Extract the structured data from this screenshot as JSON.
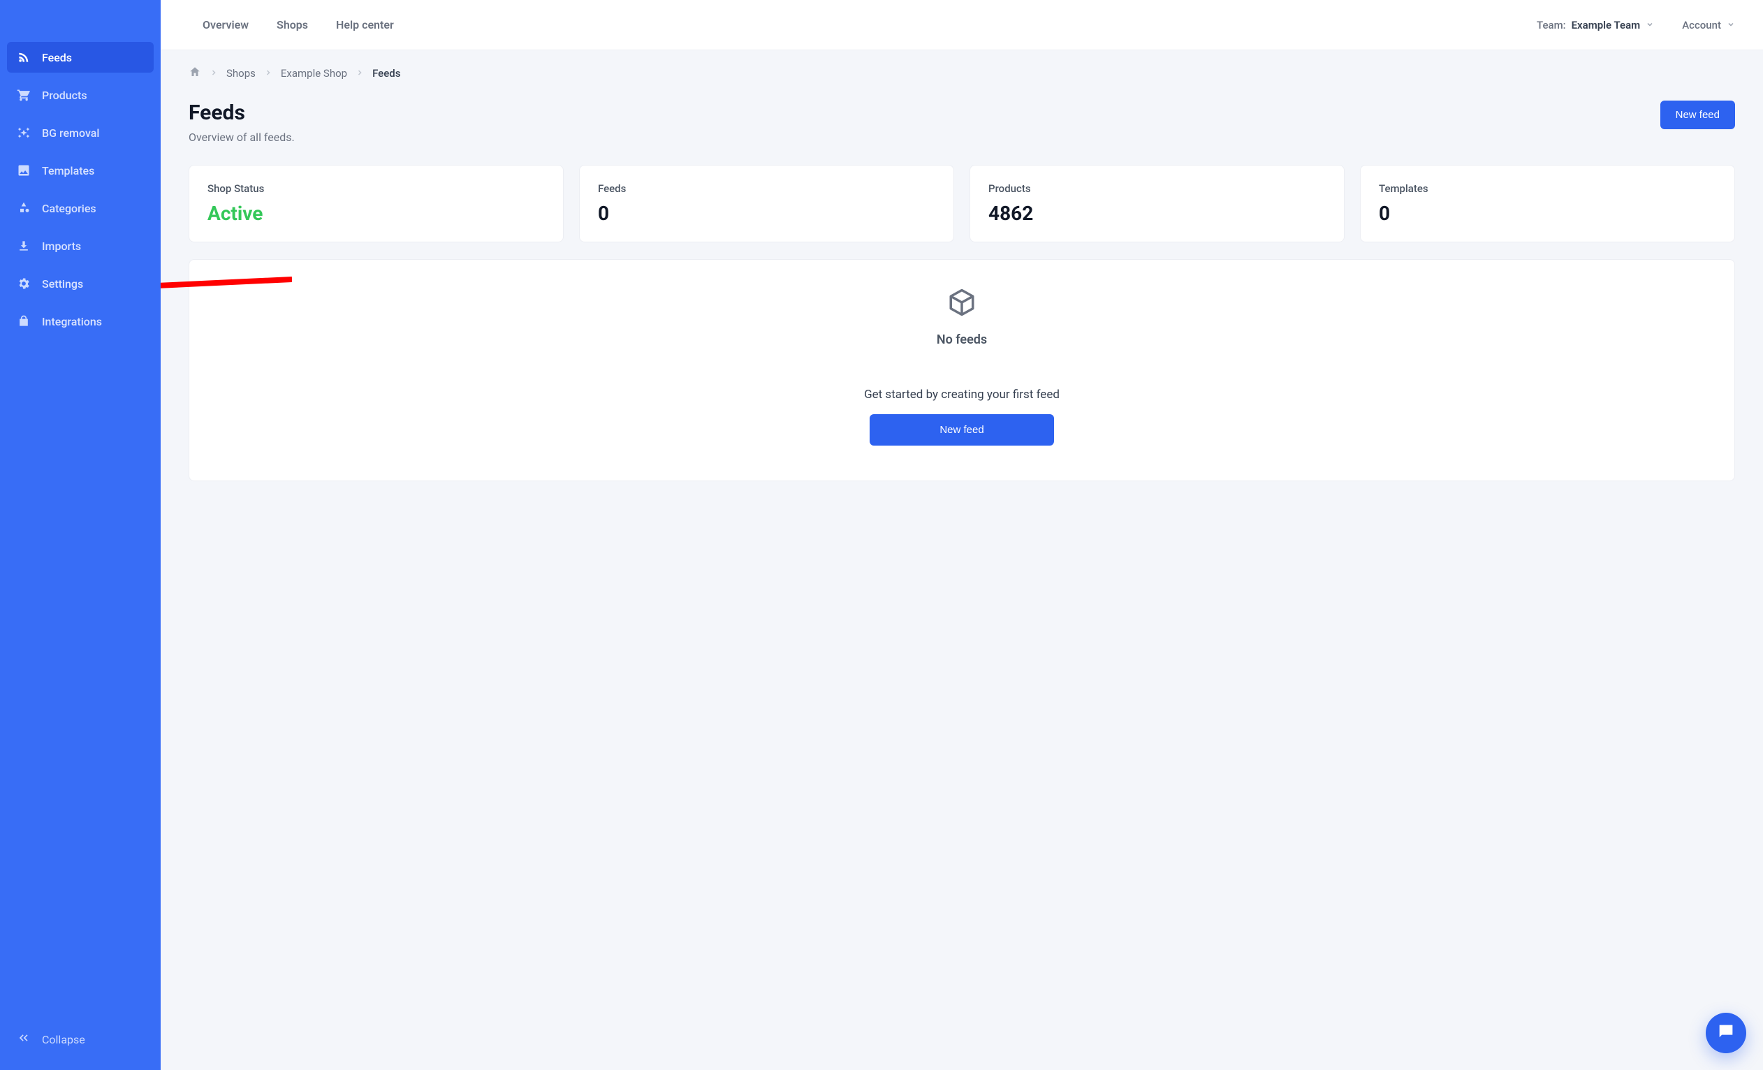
{
  "sidebar": {
    "items": [
      {
        "label": "Feeds",
        "name": "sidebar-item-feeds",
        "active": true
      },
      {
        "label": "Products",
        "name": "sidebar-item-products",
        "active": false
      },
      {
        "label": "BG removal",
        "name": "sidebar-item-bg-removal",
        "active": false
      },
      {
        "label": "Templates",
        "name": "sidebar-item-templates",
        "active": false
      },
      {
        "label": "Categories",
        "name": "sidebar-item-categories",
        "active": false
      },
      {
        "label": "Imports",
        "name": "sidebar-item-imports",
        "active": false
      },
      {
        "label": "Settings",
        "name": "sidebar-item-settings",
        "active": false
      },
      {
        "label": "Integrations",
        "name": "sidebar-item-integrations",
        "active": false
      }
    ],
    "collapse_label": "Collapse"
  },
  "topbar": {
    "nav": [
      {
        "label": "Overview"
      },
      {
        "label": "Shops"
      },
      {
        "label": "Help center"
      }
    ],
    "team_prefix": "Team: ",
    "team_name": "Example Team",
    "account_label": "Account"
  },
  "breadcrumb": {
    "items": [
      {
        "label": "Shops",
        "current": false
      },
      {
        "label": "Example Shop",
        "current": false
      },
      {
        "label": "Feeds",
        "current": true
      }
    ]
  },
  "page": {
    "title": "Feeds",
    "subtitle": "Overview of all feeds.",
    "new_feed_button": "New feed"
  },
  "stats": [
    {
      "label": "Shop Status",
      "value": "Active",
      "green": true
    },
    {
      "label": "Feeds",
      "value": "0"
    },
    {
      "label": "Products",
      "value": "4862"
    },
    {
      "label": "Templates",
      "value": "0"
    }
  ],
  "empty_state": {
    "title": "No feeds",
    "description": "Get started by creating your first feed",
    "button": "New feed"
  },
  "colors": {
    "brand_blue": "#386df6",
    "primary_button": "#2d62f0",
    "success_green": "#34c759",
    "annotation_red": "#ff0000"
  }
}
